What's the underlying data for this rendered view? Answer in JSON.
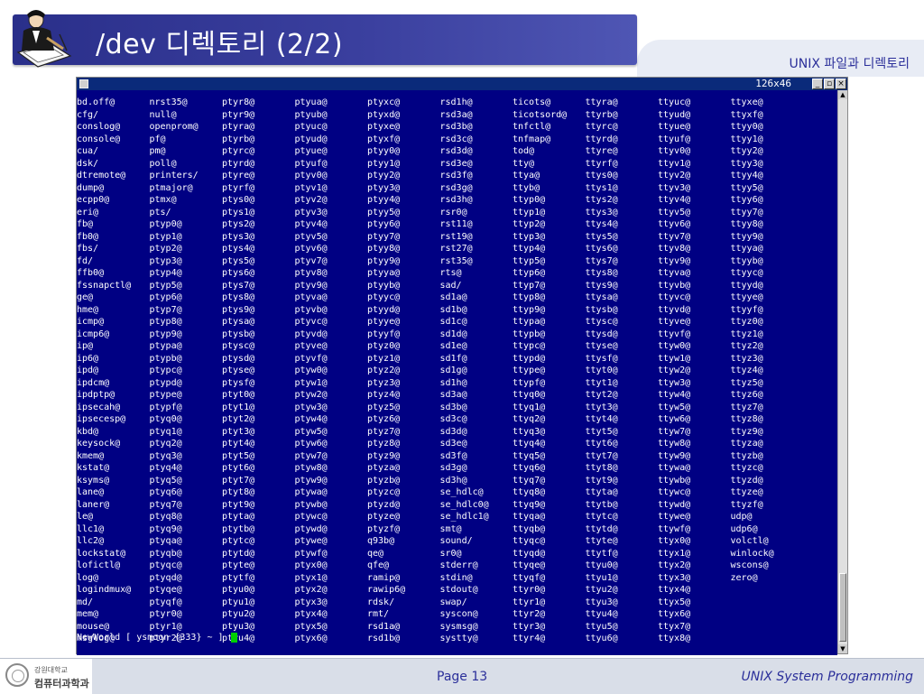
{
  "slide": {
    "title": "/dev 디렉토리 (2/2)",
    "subtitle": "UNIX 파일과 디렉토리",
    "page": "Page 13",
    "course": "UNIX System Programming",
    "univ": "강원대학교",
    "dept": "컴퓨터과학과"
  },
  "terminal": {
    "size": "126x46",
    "buttons": {
      "minimize": "_",
      "maximize": "▫",
      "close": "×"
    },
    "prompt": "NewWorld [ ysmoon {333} ~ ] ",
    "rows": [
      [
        "bd.off@",
        "nrst35@",
        "ptyr8@",
        "ptyua@",
        "ptyxc@",
        "rsd1h@",
        "ticots@",
        "ttyra@",
        "ttyuc@",
        "ttyxe@"
      ],
      [
        "cfg/",
        "null@",
        "ptyr9@",
        "ptyub@",
        "ptyxd@",
        "rsd3a@",
        "ticotsord@",
        "ttyrb@",
        "ttyud@",
        "ttyxf@"
      ],
      [
        "conslog@",
        "openprom@",
        "ptyra@",
        "ptyuc@",
        "ptyxe@",
        "rsd3b@",
        "tnfctl@",
        "ttyrc@",
        "ttyue@",
        "ttyy0@"
      ],
      [
        "console@",
        "pf@",
        "ptyrb@",
        "ptyud@",
        "ptyxf@",
        "rsd3c@",
        "tnfmap@",
        "ttyrd@",
        "ttyuf@",
        "ttyy1@"
      ],
      [
        "cua/",
        "pm@",
        "ptyrc@",
        "ptyue@",
        "ptyy0@",
        "rsd3d@",
        "tod@",
        "ttyre@",
        "ttyv0@",
        "ttyy2@"
      ],
      [
        "dsk/",
        "poll@",
        "ptyrd@",
        "ptyuf@",
        "ptyy1@",
        "rsd3e@",
        "tty@",
        "ttyrf@",
        "ttyv1@",
        "ttyy3@"
      ],
      [
        "dtremote@",
        "printers/",
        "ptyre@",
        "ptyv0@",
        "ptyy2@",
        "rsd3f@",
        "ttya@",
        "ttys0@",
        "ttyv2@",
        "ttyy4@"
      ],
      [
        "dump@",
        "ptmajor@",
        "ptyrf@",
        "ptyv1@",
        "ptyy3@",
        "rsd3g@",
        "ttyb@",
        "ttys1@",
        "ttyv3@",
        "ttyy5@"
      ],
      [
        "ecpp0@",
        "ptmx@",
        "ptys0@",
        "ptyv2@",
        "ptyy4@",
        "rsd3h@",
        "ttyp0@",
        "ttys2@",
        "ttyv4@",
        "ttyy6@"
      ],
      [
        "eri@",
        "pts/",
        "ptys1@",
        "ptyv3@",
        "ptyy5@",
        "rsr0@",
        "ttyp1@",
        "ttys3@",
        "ttyv5@",
        "ttyy7@"
      ],
      [
        "fb@",
        "ptyp0@",
        "ptys2@",
        "ptyv4@",
        "ptyy6@",
        "rst11@",
        "ttyp2@",
        "ttys4@",
        "ttyv6@",
        "ttyy8@"
      ],
      [
        "fb0@",
        "ptyp1@",
        "ptys3@",
        "ptyv5@",
        "ptyy7@",
        "rst19@",
        "ttyp3@",
        "ttys5@",
        "ttyv7@",
        "ttyy9@"
      ],
      [
        "fbs/",
        "ptyp2@",
        "ptys4@",
        "ptyv6@",
        "ptyy8@",
        "rst27@",
        "ttyp4@",
        "ttys6@",
        "ttyv8@",
        "ttyya@"
      ],
      [
        "fd/",
        "ptyp3@",
        "ptys5@",
        "ptyv7@",
        "ptyy9@",
        "rst35@",
        "ttyp5@",
        "ttys7@",
        "ttyv9@",
        "ttyyb@"
      ],
      [
        "ffb0@",
        "ptyp4@",
        "ptys6@",
        "ptyv8@",
        "ptyya@",
        "rts@",
        "ttyp6@",
        "ttys8@",
        "ttyva@",
        "ttyyc@"
      ],
      [
        "fssnapctl@",
        "ptyp5@",
        "ptys7@",
        "ptyv9@",
        "ptyyb@",
        "sad/",
        "ttyp7@",
        "ttys9@",
        "ttyvb@",
        "ttyyd@"
      ],
      [
        "ge@",
        "ptyp6@",
        "ptys8@",
        "ptyva@",
        "ptyyc@",
        "sd1a@",
        "ttyp8@",
        "ttysa@",
        "ttyvc@",
        "ttyye@"
      ],
      [
        "hme@",
        "ptyp7@",
        "ptys9@",
        "ptyvb@",
        "ptyyd@",
        "sd1b@",
        "ttyp9@",
        "ttysb@",
        "ttyvd@",
        "ttyyf@"
      ],
      [
        "icmp@",
        "ptyp8@",
        "ptysa@",
        "ptyvc@",
        "ptyye@",
        "sd1c@",
        "ttypa@",
        "ttysc@",
        "ttyve@",
        "ttyz0@"
      ],
      [
        "icmp6@",
        "ptyp9@",
        "ptysb@",
        "ptyvd@",
        "ptyyf@",
        "sd1d@",
        "ttypb@",
        "ttysd@",
        "ttyvf@",
        "ttyz1@"
      ],
      [
        "ip@",
        "ptypa@",
        "ptysc@",
        "ptyve@",
        "ptyz0@",
        "sd1e@",
        "ttypc@",
        "ttyse@",
        "ttyw0@",
        "ttyz2@"
      ],
      [
        "ip6@",
        "ptypb@",
        "ptysd@",
        "ptyvf@",
        "ptyz1@",
        "sd1f@",
        "ttypd@",
        "ttysf@",
        "ttyw1@",
        "ttyz3@"
      ],
      [
        "ipd@",
        "ptypc@",
        "ptyse@",
        "ptyw0@",
        "ptyz2@",
        "sd1g@",
        "ttype@",
        "ttyt0@",
        "ttyw2@",
        "ttyz4@"
      ],
      [
        "ipdcm@",
        "ptypd@",
        "ptysf@",
        "ptyw1@",
        "ptyz3@",
        "sd1h@",
        "ttypf@",
        "ttyt1@",
        "ttyw3@",
        "ttyz5@"
      ],
      [
        "ipdptp@",
        "ptype@",
        "ptyt0@",
        "ptyw2@",
        "ptyz4@",
        "sd3a@",
        "ttyq0@",
        "ttyt2@",
        "ttyw4@",
        "ttyz6@"
      ],
      [
        "ipsecah@",
        "ptypf@",
        "ptyt1@",
        "ptyw3@",
        "ptyz5@",
        "sd3b@",
        "ttyq1@",
        "ttyt3@",
        "ttyw5@",
        "ttyz7@"
      ],
      [
        "ipsecesp@",
        "ptyq0@",
        "ptyt2@",
        "ptyw4@",
        "ptyz6@",
        "sd3c@",
        "ttyq2@",
        "ttyt4@",
        "ttyw6@",
        "ttyz8@"
      ],
      [
        "kbd@",
        "ptyq1@",
        "ptyt3@",
        "ptyw5@",
        "ptyz7@",
        "sd3d@",
        "ttyq3@",
        "ttyt5@",
        "ttyw7@",
        "ttyz9@"
      ],
      [
        "keysock@",
        "ptyq2@",
        "ptyt4@",
        "ptyw6@",
        "ptyz8@",
        "sd3e@",
        "ttyq4@",
        "ttyt6@",
        "ttyw8@",
        "ttyza@"
      ],
      [
        "kmem@",
        "ptyq3@",
        "ptyt5@",
        "ptyw7@",
        "ptyz9@",
        "sd3f@",
        "ttyq5@",
        "ttyt7@",
        "ttyw9@",
        "ttyzb@"
      ],
      [
        "kstat@",
        "ptyq4@",
        "ptyt6@",
        "ptyw8@",
        "ptyza@",
        "sd3g@",
        "ttyq6@",
        "ttyt8@",
        "ttywa@",
        "ttyzc@"
      ],
      [
        "ksyms@",
        "ptyq5@",
        "ptyt7@",
        "ptyw9@",
        "ptyzb@",
        "sd3h@",
        "ttyq7@",
        "ttyt9@",
        "ttywb@",
        "ttyzd@"
      ],
      [
        "lane@",
        "ptyq6@",
        "ptyt8@",
        "ptywa@",
        "ptyzc@",
        "se_hdlc@",
        "ttyq8@",
        "ttyta@",
        "ttywc@",
        "ttyze@"
      ],
      [
        "laner@",
        "ptyq7@",
        "ptyt9@",
        "ptywb@",
        "ptyzd@",
        "se_hdlc0@",
        "ttyq9@",
        "ttytb@",
        "ttywd@",
        "ttyzf@"
      ],
      [
        "le@",
        "ptyq8@",
        "ptyta@",
        "ptywc@",
        "ptyze@",
        "se_hdlc1@",
        "ttyqa@",
        "ttytc@",
        "ttywe@",
        "udp@"
      ],
      [
        "llc1@",
        "ptyq9@",
        "ptytb@",
        "ptywd@",
        "ptyzf@",
        "smt@",
        "ttyqb@",
        "ttytd@",
        "ttywf@",
        "udp6@"
      ],
      [
        "llc2@",
        "ptyqa@",
        "ptytc@",
        "ptywe@",
        "q93b@",
        "sound/",
        "ttyqc@",
        "ttyte@",
        "ttyx0@",
        "volctl@"
      ],
      [
        "lockstat@",
        "ptyqb@",
        "ptytd@",
        "ptywf@",
        "qe@",
        "sr0@",
        "ttyqd@",
        "ttytf@",
        "ttyx1@",
        "winlock@"
      ],
      [
        "lofictl@",
        "ptyqc@",
        "ptyte@",
        "ptyx0@",
        "qfe@",
        "stderr@",
        "ttyqe@",
        "ttyu0@",
        "ttyx2@",
        "wscons@"
      ],
      [
        "log@",
        "ptyqd@",
        "ptytf@",
        "ptyx1@",
        "ramip@",
        "stdin@",
        "ttyqf@",
        "ttyu1@",
        "ttyx3@",
        "zero@"
      ],
      [
        "logindmux@",
        "ptyqe@",
        "ptyu0@",
        "ptyx2@",
        "rawip6@",
        "stdout@",
        "ttyr0@",
        "ttyu2@",
        "ttyx4@",
        ""
      ],
      [
        "md/",
        "ptyqf@",
        "ptyu1@",
        "ptyx3@",
        "rdsk/",
        "swap/",
        "ttyr1@",
        "ttyu3@",
        "ttyx5@",
        ""
      ],
      [
        "mem@",
        "ptyr0@",
        "ptyu2@",
        "ptyx4@",
        "rmt/",
        "syscon@",
        "ttyr2@",
        "ttyu4@",
        "ttyx6@",
        ""
      ],
      [
        "mouse@",
        "ptyr1@",
        "ptyu3@",
        "ptyx5@",
        "rsd1a@",
        "sysmsg@",
        "ttyr3@",
        "ttyu5@",
        "ttyx7@",
        ""
      ],
      [
        "msglog@",
        "ptyr2@",
        "ptyu4@",
        "ptyx6@",
        "rsd1b@",
        "systty@",
        "ttyr4@",
        "ttyu6@",
        "ttyx8@",
        ""
      ]
    ]
  },
  "colors": {
    "title_bar": "#2a2f8a",
    "terminal_bg": "#000083",
    "terminal_fg": "#ffffff",
    "cursor": "#00d000",
    "accent_text": "#2b2f9a"
  },
  "icons": {
    "logo": "writer-at-desk-icon",
    "seal": "university-seal-icon"
  }
}
